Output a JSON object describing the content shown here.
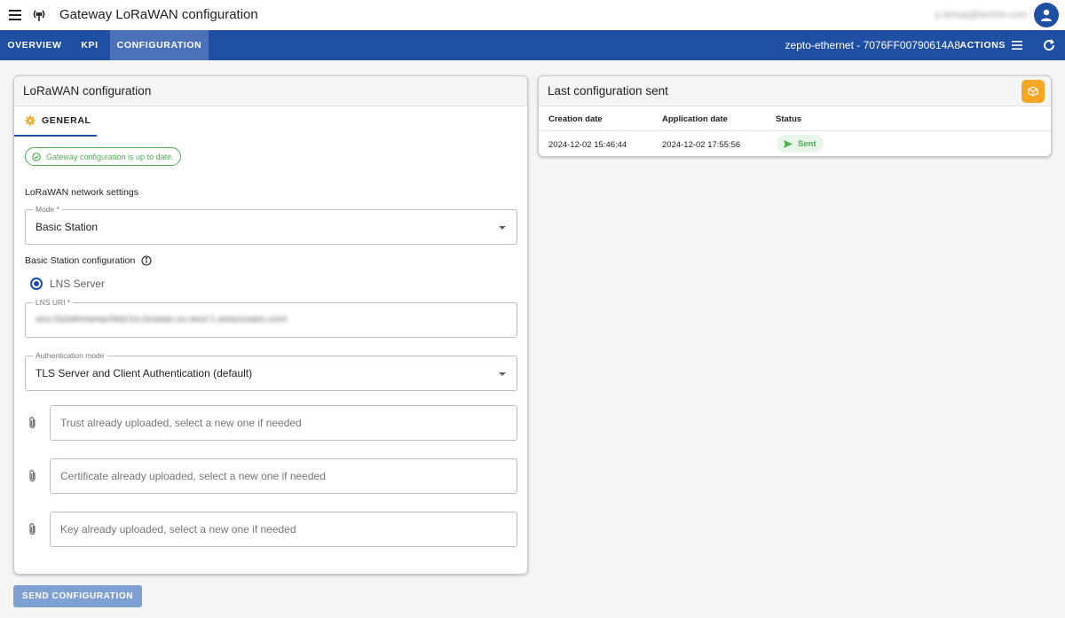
{
  "appbar": {
    "title": "Gateway LoRaWAN configuration",
    "user_email": "p.lahsaj@iterlink.com"
  },
  "navbar": {
    "tabs": [
      {
        "label": "OVERVIEW",
        "active": false
      },
      {
        "label": "KPI",
        "active": false
      },
      {
        "label": "CONFIGURATION",
        "active": true
      }
    ],
    "device": "zepto-ethernet - 7076FF00790614A8",
    "actions_label": "ACTIONS"
  },
  "config_card": {
    "title": "LoRaWAN configuration",
    "tab_general": "GENERAL",
    "status_chip": "Gateway configuration is up to date.",
    "network_settings_label": "LoRaWAN network settings",
    "mode": {
      "legend": "Mode *",
      "value": "Basic Station"
    },
    "basic_station_label": "Basic Station configuration",
    "radio_lns": "LNS Server",
    "lns_uri": {
      "legend": "LNS URI *",
      "value": "wss://a2athmamachbtd.lns.lorawan.eu-west-1.amazonaws.com/"
    },
    "auth_mode": {
      "legend": "Authentication mode",
      "value": "TLS Server and Client Authentication (default)"
    },
    "files": {
      "trust": "Trust already uploaded, select a new one if needed",
      "certificate": "Certificate already uploaded, select a new one if needed",
      "key": "Key already uploaded, select a new one if needed"
    }
  },
  "send_button": "SEND CONFIGURATION",
  "last_config_card": {
    "title": "Last configuration sent",
    "columns": [
      "Creation date",
      "Application date",
      "Status"
    ],
    "rows": [
      {
        "creation_date": "2024-12-02 15:46:44",
        "application_date": "2024-12-02 17:55:56",
        "status": "Sent"
      }
    ]
  },
  "colors": {
    "primary": "#1e4fa3",
    "active_tab": "#4b72b8",
    "success": "#4caf50",
    "warning_accent": "#f5a623",
    "send_button": "#7fa0d2"
  },
  "icons": {
    "menu": "hamburger-icon",
    "gateway": "antenna-icon",
    "avatar": "person-icon",
    "actions": "menu-lines-icon",
    "refresh": "refresh-icon",
    "general_tab": "gear-icon",
    "status_chip": "check-circle-icon",
    "info": "info-icon",
    "attachment": "paperclip-icon",
    "cube": "cube-icon",
    "sent": "send-icon"
  }
}
